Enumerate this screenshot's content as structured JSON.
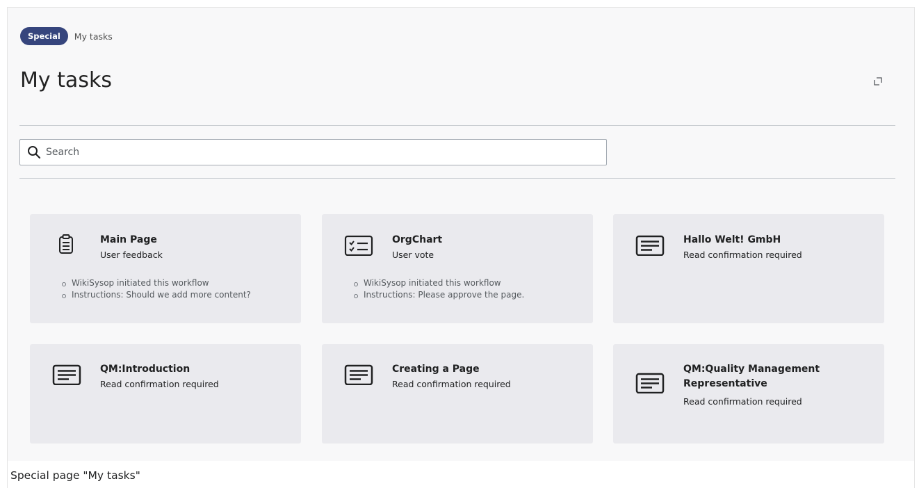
{
  "breadcrumb": {
    "badge": "Special",
    "current": "My tasks"
  },
  "page": {
    "title": "My tasks",
    "fullscreen_icon": "expand-icon"
  },
  "search": {
    "placeholder": "Search",
    "value": ""
  },
  "cards": [
    {
      "icon": "clipboard-icon",
      "title": "Main Page",
      "subtitle": "User feedback",
      "details": [
        "WikiSysop initiated this workflow",
        "Instructions: Should we add more content?"
      ]
    },
    {
      "icon": "checklist-icon",
      "title": "OrgChart",
      "subtitle": "User vote",
      "details": [
        "WikiSysop initiated this workflow",
        "Instructions: Please approve the page."
      ]
    },
    {
      "icon": "document-lines-icon",
      "title": "Hallo Welt! GmbH",
      "subtitle": "Read confirmation required",
      "details": []
    },
    {
      "icon": "document-lines-icon",
      "title": "QM:Introduction",
      "subtitle": "Read confirmation required",
      "details": []
    },
    {
      "icon": "document-lines-icon",
      "title": "Creating a Page",
      "subtitle": "Read confirmation required",
      "details": []
    },
    {
      "icon": "document-lines-icon",
      "title": "QM:Quality Management Representative",
      "subtitle": "Read confirmation required",
      "details": []
    }
  ],
  "caption": "Special page \"My tasks\"",
  "colors": {
    "badge_bg": "#36457d",
    "panel_bg": "#f8f8f9",
    "card_bg": "#eaeaee"
  }
}
